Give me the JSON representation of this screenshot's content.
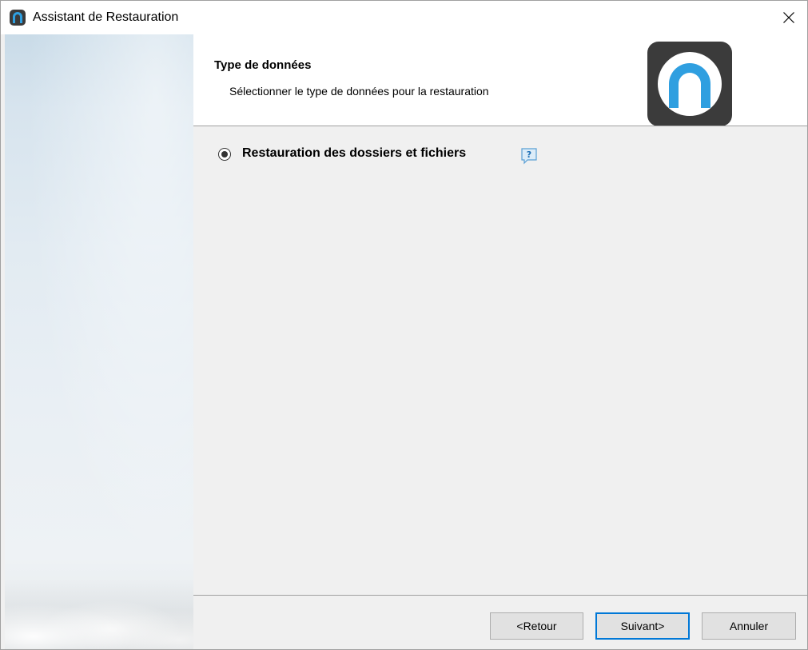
{
  "window": {
    "title": "Assistant de Restauration",
    "app_icon": "app-logo-icon",
    "close_icon": "close-icon"
  },
  "header": {
    "title": "Type de données",
    "subtitle": "Sélectionner le type de données pour la restauration",
    "logo": "app-logo-icon"
  },
  "options": [
    {
      "label": "Restauration des dossiers et fichiers",
      "selected": true,
      "help_icon": "help-icon"
    }
  ],
  "footer": {
    "back_label": "<Retour",
    "next_label": "Suivant>",
    "cancel_label": "Annuler"
  },
  "colors": {
    "accent": "#0078d7",
    "logo_blue": "#2f9fe0",
    "logo_dark": "#3b3b3b"
  }
}
